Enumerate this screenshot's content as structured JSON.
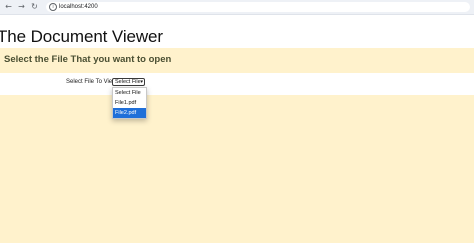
{
  "browser": {
    "url": "localhost:4200",
    "back_glyph": "←",
    "forward_glyph": "→",
    "reload_glyph": "↻",
    "info_glyph": "i"
  },
  "page": {
    "title": "The Document Viewer",
    "subtitle": "Select the File That you want to open",
    "select_label": "Select File To View",
    "selected_value": "Select File",
    "dropdown_arrow": "▾",
    "options": [
      "Select File",
      "File1.pdf",
      "File2.pdf"
    ],
    "highlighted_option": "File2.pdf"
  },
  "colors": {
    "band": "#fff2cc",
    "highlight": "#1f6fd9",
    "subtitle_text": "#4a4f32"
  }
}
